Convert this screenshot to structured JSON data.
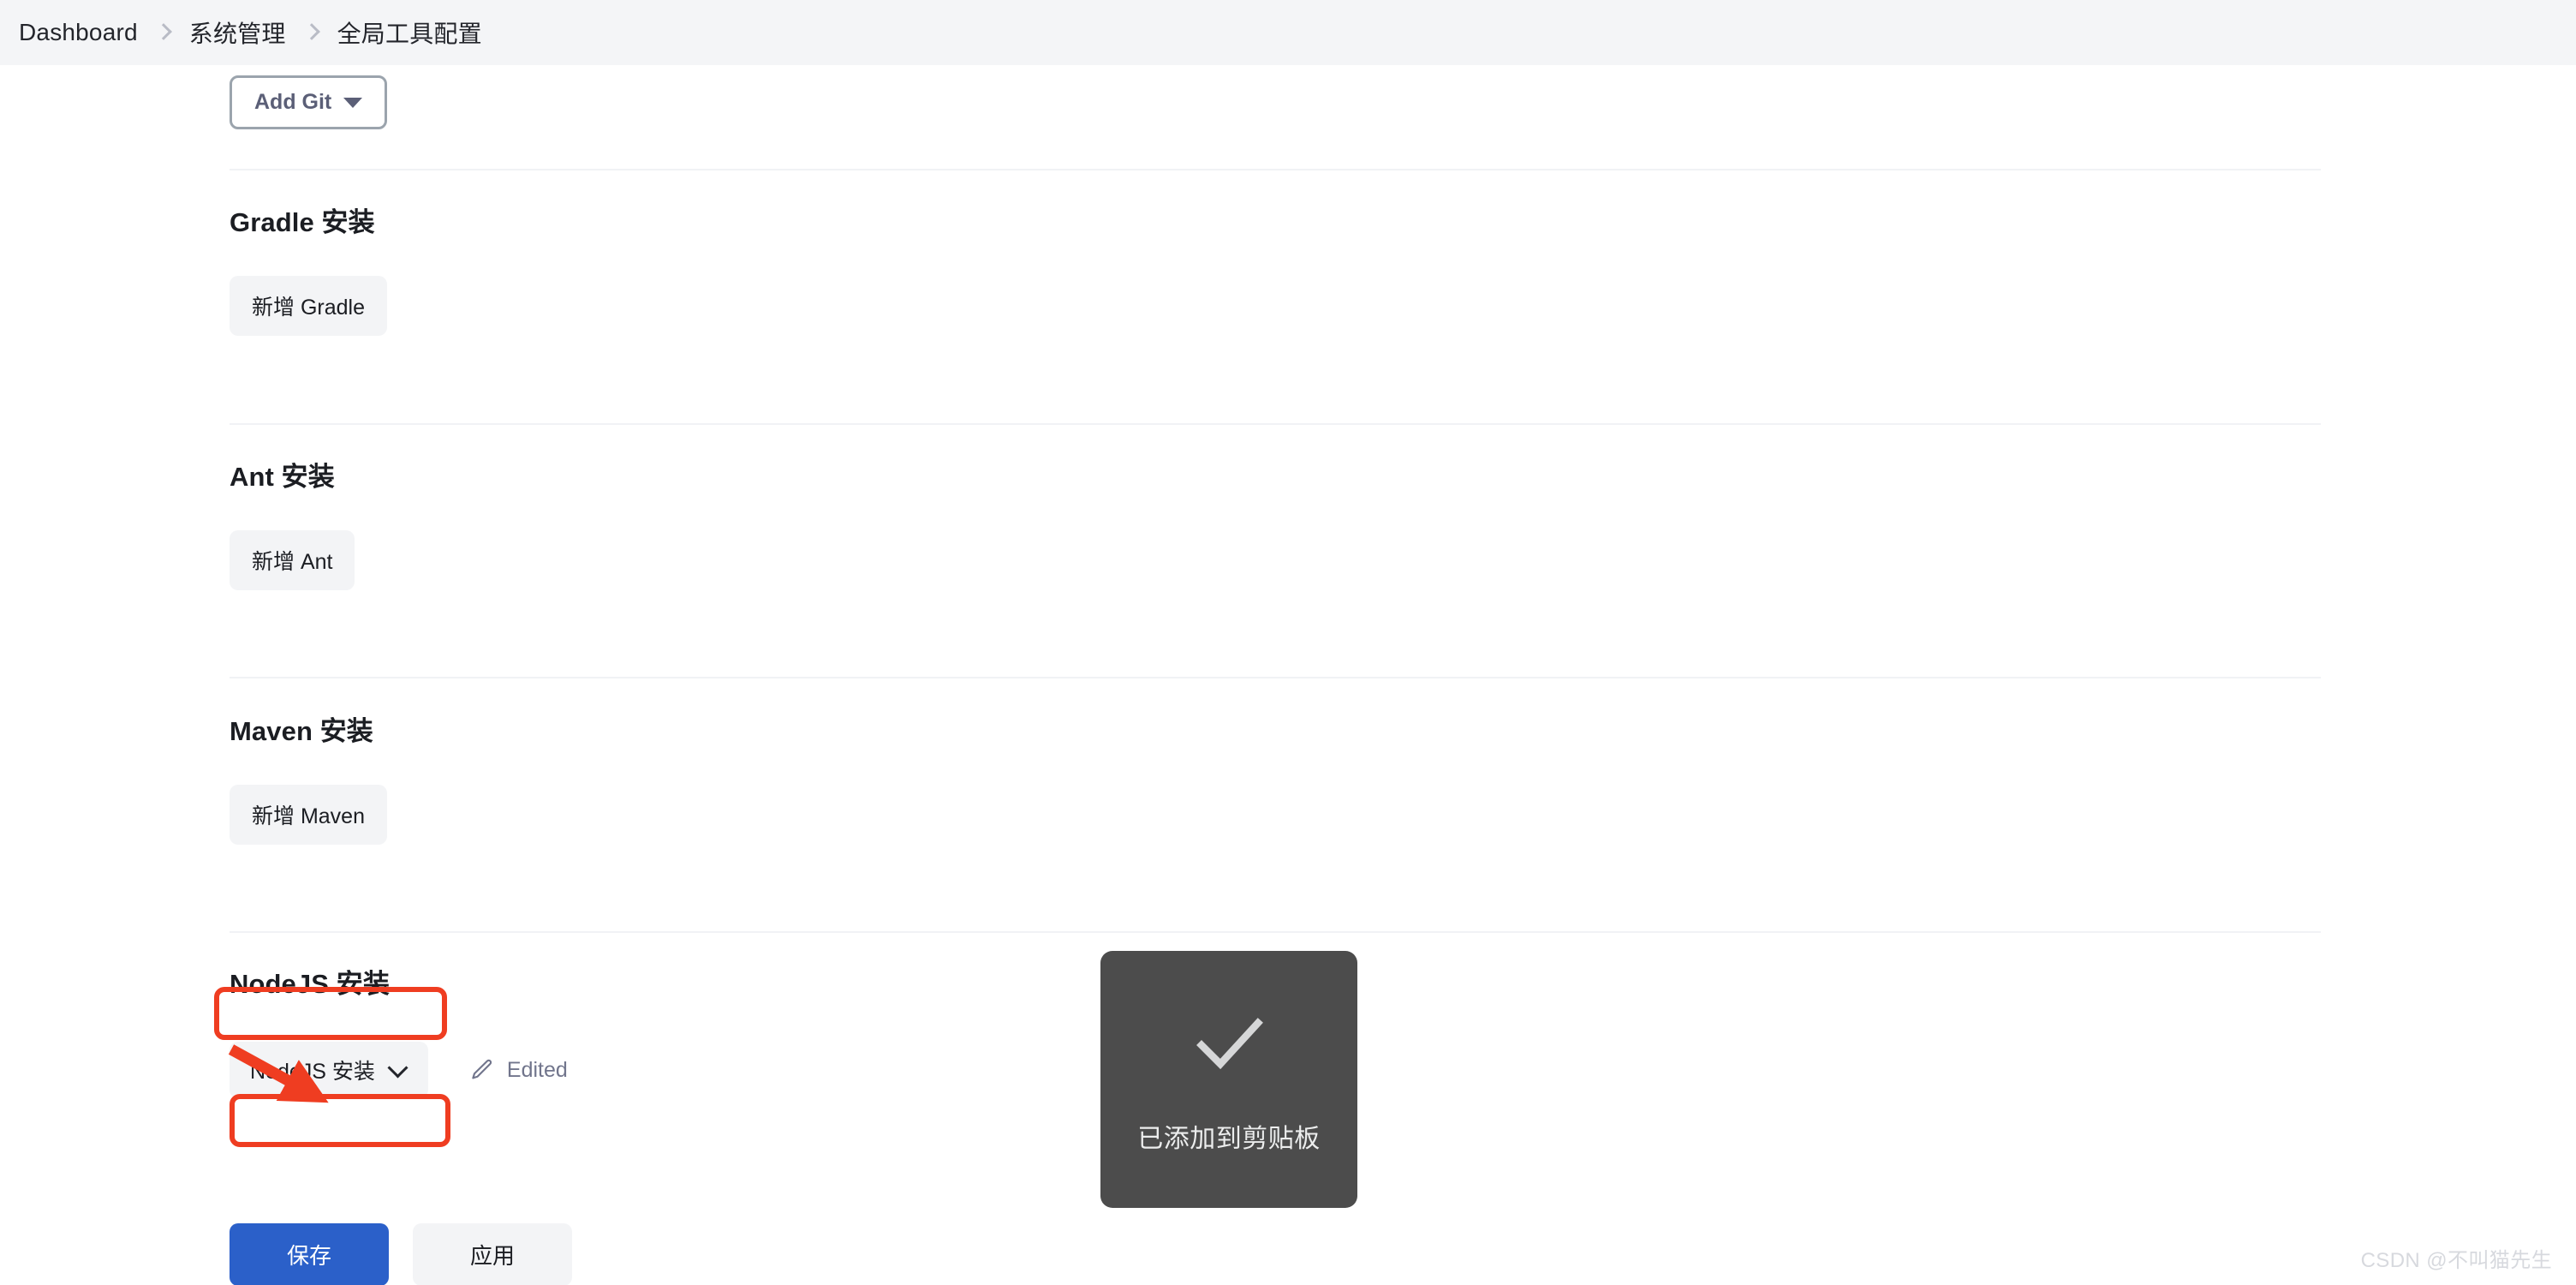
{
  "breadcrumb": {
    "items": [
      {
        "label": "Dashboard"
      },
      {
        "label": "系统管理"
      },
      {
        "label": "全局工具配置"
      }
    ]
  },
  "git_section": {
    "add_button_label": "Add Git"
  },
  "sections": [
    {
      "id": "gradle",
      "title": "Gradle 安装",
      "add_label": "新增 Gradle"
    },
    {
      "id": "ant",
      "title": "Ant 安装",
      "add_label": "新增 Ant"
    },
    {
      "id": "maven",
      "title": "Maven 安装",
      "add_label": "新增 Maven"
    },
    {
      "id": "nodejs",
      "title": "NodeJS 安装",
      "dropdown_value": "NodeJS 安装",
      "edited_label": "Edited"
    }
  ],
  "footer": {
    "save_label": "保存",
    "apply_label": "应用"
  },
  "toast": {
    "message": "已添加到剪贴板",
    "icon": "check-icon"
  },
  "watermark": {
    "text": "CSDN @不叫猫先生"
  },
  "colors": {
    "accent_blue": "#2b60c9",
    "annotation_red": "#ef3d21",
    "toast_bg": "#4c4c4c",
    "header_bg": "#f4f5f7",
    "light_button_bg": "#f3f4f6"
  }
}
